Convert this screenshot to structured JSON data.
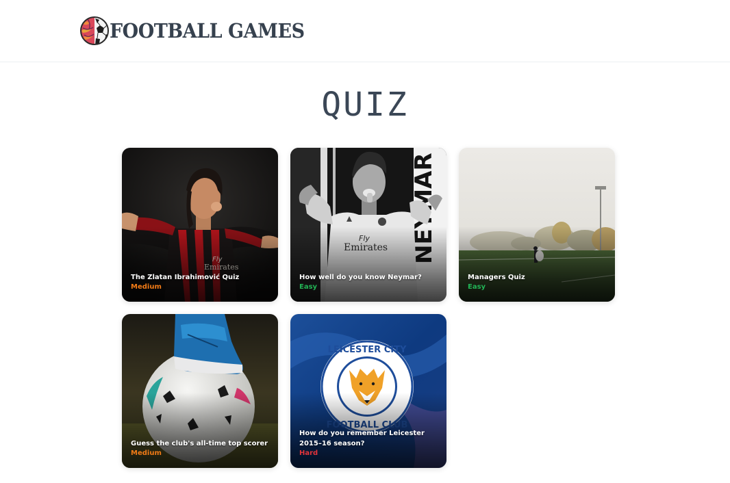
{
  "header": {
    "logo_text": "FOOTBALL GAMES",
    "logo_icon": "brain-football-icon"
  },
  "page": {
    "title": "QUIZ"
  },
  "quizzes": [
    {
      "title": "The Zlatan Ibrahimović Quiz",
      "difficulty": "Medium",
      "image": "player-red-black-kit-photo"
    },
    {
      "title": "How well do you know Neymar?",
      "difficulty": "Easy",
      "image": "neymar-poster-photo"
    },
    {
      "title": "Managers Quiz",
      "difficulty": "Easy",
      "image": "foggy-pitch-photo"
    },
    {
      "title": "Guess the club's all-time top scorer",
      "difficulty": "Medium",
      "image": "boot-on-ball-photo"
    },
    {
      "title": "How do you remember Leicester 2015–16 season?",
      "difficulty": "Hard",
      "image": "leicester-crest-photo"
    }
  ],
  "colors": {
    "medium": "#f07a16",
    "easy": "#22b455",
    "hard": "#e3343a",
    "title": "#3b4756"
  }
}
